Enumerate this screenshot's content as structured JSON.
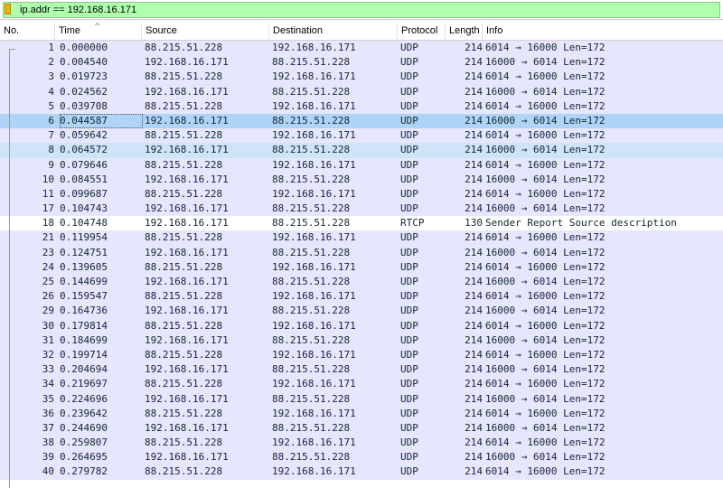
{
  "filter": {
    "text": "ip.addr == 192.168.16.171",
    "icon": "bookmark-icon"
  },
  "columns": [
    "No.",
    "Time",
    "Source",
    "Destination",
    "Protocol",
    "Length",
    "Info"
  ],
  "sort_indicator": "^",
  "colors": {
    "filter_ok": "#afffaf",
    "udp_row": "#e7e6ff",
    "selected_row": "#aed4f7",
    "related_row": "#cfe4f8"
  },
  "selected_no": "6",
  "related_no": "8",
  "packets": [
    {
      "no": "1",
      "time": "0.000000",
      "src": "88.215.51.228",
      "dst": "192.168.16.171",
      "proto": "UDP",
      "len": "214",
      "info": "6014 → 16000 Len=172"
    },
    {
      "no": "2",
      "time": "0.004540",
      "src": "192.168.16.171",
      "dst": "88.215.51.228",
      "proto": "UDP",
      "len": "214",
      "info": "16000 → 6014 Len=172"
    },
    {
      "no": "3",
      "time": "0.019723",
      "src": "88.215.51.228",
      "dst": "192.168.16.171",
      "proto": "UDP",
      "len": "214",
      "info": "6014 → 16000 Len=172"
    },
    {
      "no": "4",
      "time": "0.024562",
      "src": "192.168.16.171",
      "dst": "88.215.51.228",
      "proto": "UDP",
      "len": "214",
      "info": "16000 → 6014 Len=172"
    },
    {
      "no": "5",
      "time": "0.039708",
      "src": "88.215.51.228",
      "dst": "192.168.16.171",
      "proto": "UDP",
      "len": "214",
      "info": "6014 → 16000 Len=172"
    },
    {
      "no": "6",
      "time": "0.044587",
      "src": "192.168.16.171",
      "dst": "88.215.51.228",
      "proto": "UDP",
      "len": "214",
      "info": "16000 → 6014 Len=172"
    },
    {
      "no": "7",
      "time": "0.059642",
      "src": "88.215.51.228",
      "dst": "192.168.16.171",
      "proto": "UDP",
      "len": "214",
      "info": "6014 → 16000 Len=172"
    },
    {
      "no": "8",
      "time": "0.064572",
      "src": "192.168.16.171",
      "dst": "88.215.51.228",
      "proto": "UDP",
      "len": "214",
      "info": "16000 → 6014 Len=172"
    },
    {
      "no": "9",
      "time": "0.079646",
      "src": "88.215.51.228",
      "dst": "192.168.16.171",
      "proto": "UDP",
      "len": "214",
      "info": "6014 → 16000 Len=172"
    },
    {
      "no": "10",
      "time": "0.084551",
      "src": "192.168.16.171",
      "dst": "88.215.51.228",
      "proto": "UDP",
      "len": "214",
      "info": "16000 → 6014 Len=172"
    },
    {
      "no": "11",
      "time": "0.099687",
      "src": "88.215.51.228",
      "dst": "192.168.16.171",
      "proto": "UDP",
      "len": "214",
      "info": "6014 → 16000 Len=172"
    },
    {
      "no": "17",
      "time": "0.104743",
      "src": "192.168.16.171",
      "dst": "88.215.51.228",
      "proto": "UDP",
      "len": "214",
      "info": "16000 → 6014 Len=172"
    },
    {
      "no": "18",
      "time": "0.104748",
      "src": "192.168.16.171",
      "dst": "88.215.51.228",
      "proto": "RTCP",
      "len": "130",
      "info": "Sender Report   Source description"
    },
    {
      "no": "21",
      "time": "0.119954",
      "src": "88.215.51.228",
      "dst": "192.168.16.171",
      "proto": "UDP",
      "len": "214",
      "info": "6014 → 16000 Len=172"
    },
    {
      "no": "23",
      "time": "0.124751",
      "src": "192.168.16.171",
      "dst": "88.215.51.228",
      "proto": "UDP",
      "len": "214",
      "info": "16000 → 6014 Len=172"
    },
    {
      "no": "24",
      "time": "0.139605",
      "src": "88.215.51.228",
      "dst": "192.168.16.171",
      "proto": "UDP",
      "len": "214",
      "info": "6014 → 16000 Len=172"
    },
    {
      "no": "25",
      "time": "0.144699",
      "src": "192.168.16.171",
      "dst": "88.215.51.228",
      "proto": "UDP",
      "len": "214",
      "info": "16000 → 6014 Len=172"
    },
    {
      "no": "26",
      "time": "0.159547",
      "src": "88.215.51.228",
      "dst": "192.168.16.171",
      "proto": "UDP",
      "len": "214",
      "info": "6014 → 16000 Len=172"
    },
    {
      "no": "29",
      "time": "0.164736",
      "src": "192.168.16.171",
      "dst": "88.215.51.228",
      "proto": "UDP",
      "len": "214",
      "info": "16000 → 6014 Len=172"
    },
    {
      "no": "30",
      "time": "0.179814",
      "src": "88.215.51.228",
      "dst": "192.168.16.171",
      "proto": "UDP",
      "len": "214",
      "info": "6014 → 16000 Len=172"
    },
    {
      "no": "31",
      "time": "0.184699",
      "src": "192.168.16.171",
      "dst": "88.215.51.228",
      "proto": "UDP",
      "len": "214",
      "info": "16000 → 6014 Len=172"
    },
    {
      "no": "32",
      "time": "0.199714",
      "src": "88.215.51.228",
      "dst": "192.168.16.171",
      "proto": "UDP",
      "len": "214",
      "info": "6014 → 16000 Len=172"
    },
    {
      "no": "33",
      "time": "0.204694",
      "src": "192.168.16.171",
      "dst": "88.215.51.228",
      "proto": "UDP",
      "len": "214",
      "info": "16000 → 6014 Len=172"
    },
    {
      "no": "34",
      "time": "0.219697",
      "src": "88.215.51.228",
      "dst": "192.168.16.171",
      "proto": "UDP",
      "len": "214",
      "info": "6014 → 16000 Len=172"
    },
    {
      "no": "35",
      "time": "0.224696",
      "src": "192.168.16.171",
      "dst": "88.215.51.228",
      "proto": "UDP",
      "len": "214",
      "info": "16000 → 6014 Len=172"
    },
    {
      "no": "36",
      "time": "0.239642",
      "src": "88.215.51.228",
      "dst": "192.168.16.171",
      "proto": "UDP",
      "len": "214",
      "info": "6014 → 16000 Len=172"
    },
    {
      "no": "37",
      "time": "0.244690",
      "src": "192.168.16.171",
      "dst": "88.215.51.228",
      "proto": "UDP",
      "len": "214",
      "info": "16000 → 6014 Len=172"
    },
    {
      "no": "38",
      "time": "0.259807",
      "src": "88.215.51.228",
      "dst": "192.168.16.171",
      "proto": "UDP",
      "len": "214",
      "info": "6014 → 16000 Len=172"
    },
    {
      "no": "39",
      "time": "0.264695",
      "src": "192.168.16.171",
      "dst": "88.215.51.228",
      "proto": "UDP",
      "len": "214",
      "info": "16000 → 6014 Len=172"
    },
    {
      "no": "40",
      "time": "0.279782",
      "src": "88.215.51.228",
      "dst": "192.168.16.171",
      "proto": "UDP",
      "len": "214",
      "info": "6014 → 16000 Len=172"
    }
  ]
}
